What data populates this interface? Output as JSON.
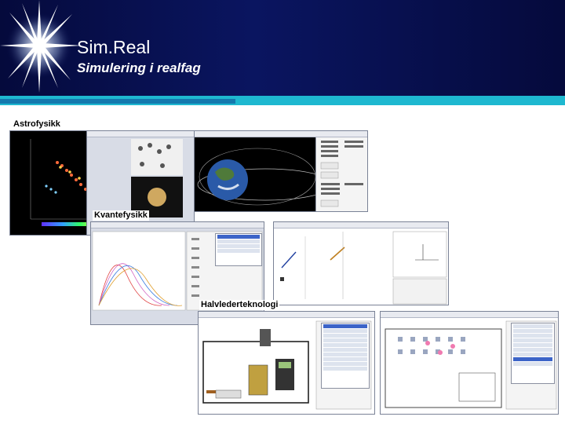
{
  "slide": {
    "title": "Sim.Real",
    "subtitle": "Simulering i realfag"
  },
  "panels": [
    {
      "label": "Astrofysikk"
    },
    {
      "label": "Kvantefysikk"
    },
    {
      "label": "Halvlederteknologi"
    }
  ],
  "colors": {
    "header_bg": "#0a1560",
    "band": "#1eb8d0",
    "title_text": "#ffffff"
  }
}
